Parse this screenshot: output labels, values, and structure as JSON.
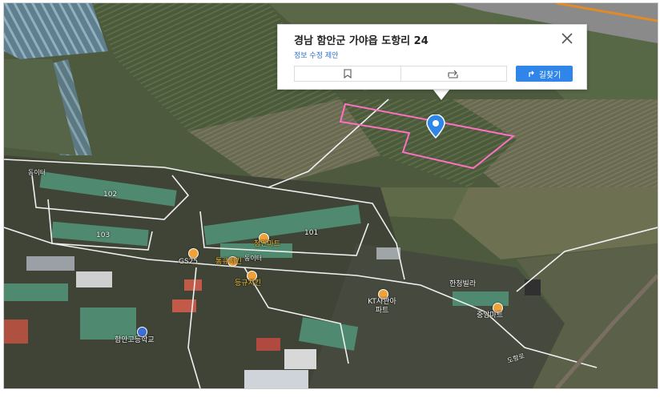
{
  "popup": {
    "address": "경남 함안군 가야읍 도항리 24",
    "edit_link": "정보 수정 제안",
    "bookmark_icon": "bookmark-icon",
    "share_icon": "share-icon",
    "close_icon": "close-icon",
    "directions_label": "길찾기"
  },
  "colors": {
    "parcel_outline": "#ff6fc2",
    "pin": "#2f86e8",
    "directions_button": "#2f86e8",
    "link": "#2f6fd0"
  },
  "map_labels": {
    "dongitop": "동이터",
    "bldg_102": "102",
    "bldg_103": "103",
    "bldg_101": "101",
    "dongi_mid": "동이터",
    "gs25": "GS25",
    "mart": "청인마트",
    "chicken1": "통큐치킨",
    "chicken2": "등규치킨",
    "villa": "한청빌라",
    "kt_apt": "KT사관아파트",
    "mart2": "중앙마트",
    "school": "함안고등학교",
    "road": "도항로"
  }
}
